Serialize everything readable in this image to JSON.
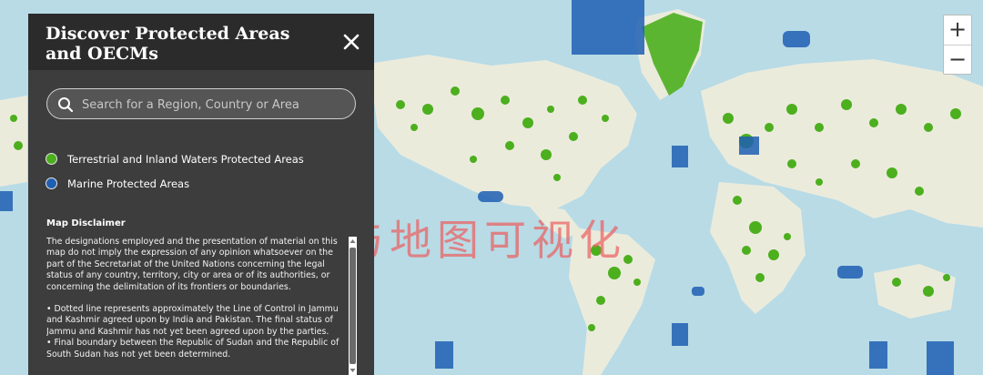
{
  "panel": {
    "title": "Discover Protected Areas and OECMs",
    "search_placeholder": "Search for a Region, Country or Area",
    "legend": [
      {
        "label": "Terrestrial and Inland Waters Protected Areas",
        "color": "#4caf1e"
      },
      {
        "label": "Marine Protected Areas",
        "color": "#1f5fb3"
      }
    ],
    "disclaimer_title": "Map Disclaimer",
    "disclaimer_intro": "The designations employed and the presentation of material on this map do not imply the expression of any opinion whatsoever on the part of the Secretariat of the United Nations concerning the legal status of any country, territory, city or area or of its authorities, or concerning the delimitation of its frontiers or boundaries.",
    "disclaimer_bullets": [
      "• Dotted line represents approximately the Line of Control in Jammu and Kashmir agreed upon by India and Pakistan. The final status of Jammu and Kashmir has not yet been agreed upon by the parties.",
      "• Final boundary between the Republic of Sudan and the Republic of South Sudan has not yet been determined."
    ]
  },
  "zoom": {
    "in_label": "+",
    "out_label": "−"
  },
  "watermark": "智能遥感与地图可视化",
  "colors": {
    "ocean": "#b8dbe6",
    "land": "#ebebdc",
    "terrestrial": "#4caf1e",
    "marine": "#1f5fb3",
    "panel": "#3d3d3d"
  }
}
